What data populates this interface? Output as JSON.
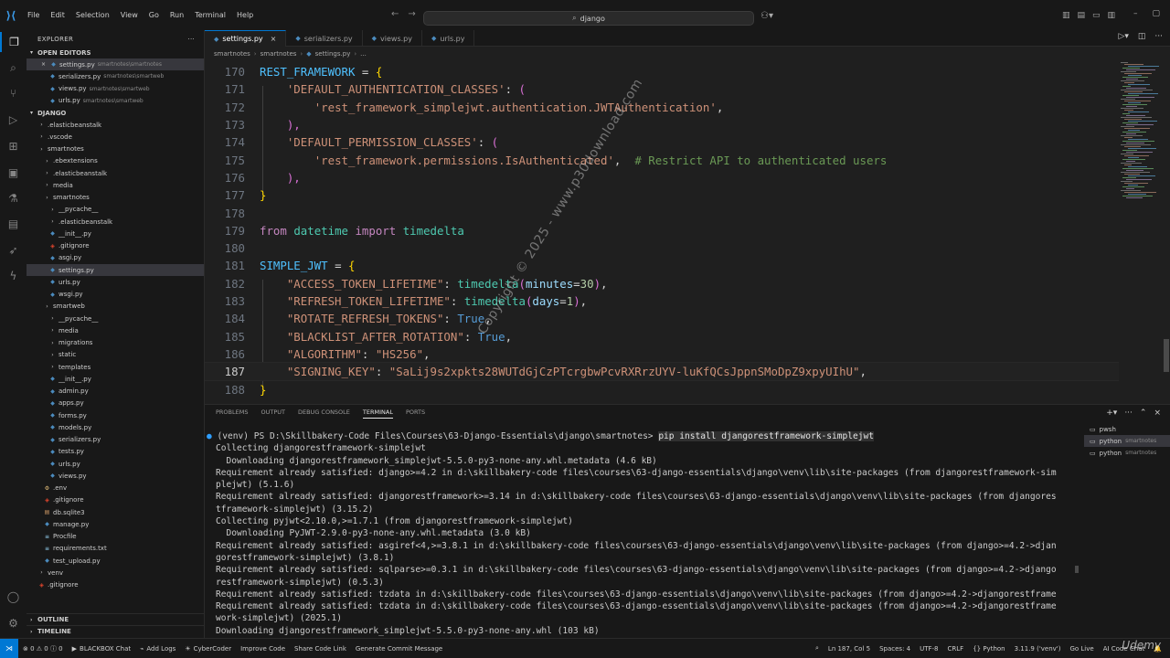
{
  "titlebar": {
    "menu": [
      "File",
      "Edit",
      "Selection",
      "View",
      "Go",
      "Run",
      "Terminal",
      "Help"
    ],
    "search_text": "django"
  },
  "sidebar": {
    "title": "EXPLORER",
    "open_editors_label": "OPEN EDITORS",
    "open_editors": [
      {
        "name": "settings.py",
        "path": "smartnotes\\smartnotes"
      },
      {
        "name": "serializers.py",
        "path": "smartnotes\\smartweb"
      },
      {
        "name": "views.py",
        "path": "smartnotes\\smartweb"
      },
      {
        "name": "urls.py",
        "path": "smartnotes\\smartweb"
      }
    ],
    "workspace_label": "DJANGO",
    "tree": [
      {
        "name": ".elasticbeanstalk",
        "indent": 1,
        "type": "folder"
      },
      {
        "name": ".vscode",
        "indent": 1,
        "type": "folder"
      },
      {
        "name": "smartnotes",
        "indent": 1,
        "type": "folder"
      },
      {
        "name": ".ebextensions",
        "indent": 2,
        "type": "folder"
      },
      {
        "name": ".elasticbeanstalk",
        "indent": 2,
        "type": "folder"
      },
      {
        "name": "media",
        "indent": 2,
        "type": "folder"
      },
      {
        "name": "smartnotes",
        "indent": 2,
        "type": "folder"
      },
      {
        "name": "__pycache__",
        "indent": 3,
        "type": "folder"
      },
      {
        "name": ".elasticbeanstalk",
        "indent": 3,
        "type": "folder"
      },
      {
        "name": "__init__.py",
        "indent": 3,
        "type": "py"
      },
      {
        "name": ".gitignore",
        "indent": 3,
        "type": "git"
      },
      {
        "name": "asgi.py",
        "indent": 3,
        "type": "py"
      },
      {
        "name": "settings.py",
        "indent": 3,
        "type": "py"
      },
      {
        "name": "urls.py",
        "indent": 3,
        "type": "py"
      },
      {
        "name": "wsgi.py",
        "indent": 3,
        "type": "py"
      },
      {
        "name": "smartweb",
        "indent": 2,
        "type": "folder"
      },
      {
        "name": "__pycache__",
        "indent": 3,
        "type": "folder"
      },
      {
        "name": "media",
        "indent": 3,
        "type": "folder"
      },
      {
        "name": "migrations",
        "indent": 3,
        "type": "folder"
      },
      {
        "name": "static",
        "indent": 3,
        "type": "folder"
      },
      {
        "name": "templates",
        "indent": 3,
        "type": "folder"
      },
      {
        "name": "__init__.py",
        "indent": 3,
        "type": "py"
      },
      {
        "name": "admin.py",
        "indent": 3,
        "type": "py"
      },
      {
        "name": "apps.py",
        "indent": 3,
        "type": "py"
      },
      {
        "name": "forms.py",
        "indent": 3,
        "type": "py"
      },
      {
        "name": "models.py",
        "indent": 3,
        "type": "py"
      },
      {
        "name": "serializers.py",
        "indent": 3,
        "type": "py"
      },
      {
        "name": "tests.py",
        "indent": 3,
        "type": "py"
      },
      {
        "name": "urls.py",
        "indent": 3,
        "type": "py"
      },
      {
        "name": "views.py",
        "indent": 3,
        "type": "py"
      },
      {
        "name": ".env",
        "indent": 2,
        "type": "env"
      },
      {
        "name": ".gitignore",
        "indent": 2,
        "type": "git"
      },
      {
        "name": "db.sqlite3",
        "indent": 2,
        "type": "db"
      },
      {
        "name": "manage.py",
        "indent": 2,
        "type": "py"
      },
      {
        "name": "Procfile",
        "indent": 2,
        "type": "txt"
      },
      {
        "name": "requirements.txt",
        "indent": 2,
        "type": "txt"
      },
      {
        "name": "test_upload.py",
        "indent": 2,
        "type": "py"
      },
      {
        "name": "venv",
        "indent": 1,
        "type": "folder"
      },
      {
        "name": ".gitignore",
        "indent": 1,
        "type": "git"
      }
    ],
    "outline_label": "OUTLINE",
    "timeline_label": "TIMELINE"
  },
  "tabs": [
    {
      "label": "settings.py",
      "active": true
    },
    {
      "label": "serializers.py",
      "active": false
    },
    {
      "label": "views.py",
      "active": false
    },
    {
      "label": "urls.py",
      "active": false
    }
  ],
  "breadcrumb": [
    "smartnotes",
    "smartnotes",
    "settings.py",
    "..."
  ],
  "editor": {
    "current_line": 187,
    "lines": [
      {
        "n": 170,
        "tokens": [
          [
            "REST_FRAMEWORK",
            "var"
          ],
          [
            " = ",
            "op"
          ],
          [
            "{",
            "br1"
          ]
        ]
      },
      {
        "n": 171,
        "tokens": [
          [
            "    ",
            "plain"
          ],
          [
            "'DEFAULT_AUTHENTICATION_CLASSES'",
            "str"
          ],
          [
            ": ",
            "op"
          ],
          [
            "(",
            "br2"
          ]
        ]
      },
      {
        "n": 172,
        "tokens": [
          [
            "        ",
            "plain"
          ],
          [
            "'rest_framework_simplejwt.authentication.JWTAuthentication'",
            "str"
          ],
          [
            ",",
            "op"
          ]
        ]
      },
      {
        "n": 173,
        "tokens": [
          [
            "    ",
            "plain"
          ],
          [
            "),",
            "br2"
          ]
        ]
      },
      {
        "n": 174,
        "tokens": [
          [
            "    ",
            "plain"
          ],
          [
            "'DEFAULT_PERMISSION_CLASSES'",
            "str"
          ],
          [
            ": ",
            "op"
          ],
          [
            "(",
            "br2"
          ]
        ]
      },
      {
        "n": 175,
        "tokens": [
          [
            "        ",
            "plain"
          ],
          [
            "'rest_framework.permissions.IsAuthenticated'",
            "str"
          ],
          [
            ",  ",
            "op"
          ],
          [
            "# Restrict API to authenticated users",
            "com"
          ]
        ]
      },
      {
        "n": 176,
        "tokens": [
          [
            "    ",
            "plain"
          ],
          [
            "),",
            "br2"
          ]
        ]
      },
      {
        "n": 177,
        "tokens": [
          [
            "}",
            "br1"
          ]
        ]
      },
      {
        "n": 178,
        "tokens": []
      },
      {
        "n": 179,
        "tokens": [
          [
            "from",
            "kw"
          ],
          [
            " ",
            "plain"
          ],
          [
            "datetime",
            "id"
          ],
          [
            " ",
            "plain"
          ],
          [
            "import",
            "kw"
          ],
          [
            " ",
            "plain"
          ],
          [
            "timedelta",
            "id"
          ]
        ]
      },
      {
        "n": 180,
        "tokens": []
      },
      {
        "n": 181,
        "tokens": [
          [
            "SIMPLE_JWT",
            "var"
          ],
          [
            " = ",
            "op"
          ],
          [
            "{",
            "br1"
          ]
        ]
      },
      {
        "n": 182,
        "tokens": [
          [
            "    ",
            "plain"
          ],
          [
            "\"ACCESS_TOKEN_LIFETIME\"",
            "str"
          ],
          [
            ": ",
            "op"
          ],
          [
            "timedelta",
            "fn"
          ],
          [
            "(",
            "br2"
          ],
          [
            "minutes",
            "param"
          ],
          [
            "=",
            "op"
          ],
          [
            "30",
            "num"
          ],
          [
            ")",
            "br2"
          ],
          [
            ",",
            "op"
          ]
        ]
      },
      {
        "n": 183,
        "tokens": [
          [
            "    ",
            "plain"
          ],
          [
            "\"REFRESH_TOKEN_LIFETIME\"",
            "str"
          ],
          [
            ": ",
            "op"
          ],
          [
            "timedelta",
            "fn"
          ],
          [
            "(",
            "br2"
          ],
          [
            "days",
            "param"
          ],
          [
            "=",
            "op"
          ],
          [
            "1",
            "num"
          ],
          [
            ")",
            "br2"
          ],
          [
            ",",
            "op"
          ]
        ]
      },
      {
        "n": 184,
        "tokens": [
          [
            "    ",
            "plain"
          ],
          [
            "\"ROTATE_REFRESH_TOKENS\"",
            "str"
          ],
          [
            ": ",
            "op"
          ],
          [
            "True",
            "bool"
          ],
          [
            ",",
            "op"
          ]
        ]
      },
      {
        "n": 185,
        "tokens": [
          [
            "    ",
            "plain"
          ],
          [
            "\"BLACKLIST_AFTER_ROTATION\"",
            "str"
          ],
          [
            ": ",
            "op"
          ],
          [
            "True",
            "bool"
          ],
          [
            ",",
            "op"
          ]
        ]
      },
      {
        "n": 186,
        "tokens": [
          [
            "    ",
            "plain"
          ],
          [
            "\"ALGORITHM\"",
            "str"
          ],
          [
            ": ",
            "op"
          ],
          [
            "\"HS256\"",
            "str"
          ],
          [
            ",",
            "op"
          ]
        ]
      },
      {
        "n": 187,
        "tokens": [
          [
            "    ",
            "plain"
          ],
          [
            "\"SIGNING_KEY\"",
            "str"
          ],
          [
            ": ",
            "op"
          ],
          [
            "\"SaLij9s2xpkts28WUTdGjCzPTcrgbwPcvRXRrzUYV-luKfQCsJppnSMoDpZ9xpyUIhU\"",
            "str"
          ],
          [
            ",",
            "op"
          ]
        ]
      },
      {
        "n": 188,
        "tokens": [
          [
            "}",
            "br1"
          ]
        ]
      }
    ]
  },
  "watermark": "Copyright © 2025 - www.p30download.com",
  "panel": {
    "tabs": [
      "PROBLEMS",
      "OUTPUT",
      "DEBUG CONSOLE",
      "TERMINAL",
      "PORTS"
    ],
    "active_tab": "TERMINAL",
    "prompt": "(venv) PS D:\\Skillbakery-Code Files\\Courses\\63-Django-Essentials\\django\\smartnotes>",
    "command": "pip install djangorestframework-simplejwt",
    "output": [
      "Collecting djangorestframework-simplejwt",
      "  Downloading djangorestframework_simplejwt-5.5.0-py3-none-any.whl.metadata (4.6 kB)",
      "Requirement already satisfied: django>=4.2 in d:\\skillbakery-code files\\courses\\63-django-essentials\\django\\venv\\lib\\site-packages (from djangorestframework-sim",
      "plejwt) (5.1.6)",
      "Requirement already satisfied: djangorestframework>=3.14 in d:\\skillbakery-code files\\courses\\63-django-essentials\\django\\venv\\lib\\site-packages (from djangores",
      "tframework-simplejwt) (3.15.2)",
      "Collecting pyjwt<2.10.0,>=1.7.1 (from djangorestframework-simplejwt)",
      "  Downloading PyJWT-2.9.0-py3-none-any.whl.metadata (3.0 kB)",
      "Requirement already satisfied: asgiref<4,>=3.8.1 in d:\\skillbakery-code files\\courses\\63-django-essentials\\django\\venv\\lib\\site-packages (from django>=4.2->djan",
      "gorestframework-simplejwt) (3.8.1)",
      "Requirement already satisfied: sqlparse>=0.3.1 in d:\\skillbakery-code files\\courses\\63-django-essentials\\django\\venv\\lib\\site-packages (from django>=4.2->django",
      "restframework-simplejwt) (0.5.3)",
      "Requirement already satisfied: tzdata in d:\\skillbakery-code files\\courses\\63-django-essentials\\django\\venv\\lib\\site-packages (from django>=4.2->djangorestframe",
      "Requirement already satisfied: tzdata in d:\\skillbakery-code files\\courses\\63-django-essentials\\django\\venv\\lib\\site-packages (from django>=4.2->djangorestframe",
      "work-simplejwt) (2025.1)",
      "Downloading djangorestframework_simplejwt-5.5.0-py3-none-any.whl (103 kB)"
    ],
    "terminals": [
      {
        "name": "pwsh",
        "sub": ""
      },
      {
        "name": "python",
        "sub": "smartnotes"
      },
      {
        "name": "python",
        "sub": "smartnotes"
      }
    ]
  },
  "statusbar": {
    "problems": "⊗ 0 ⚠ 0 ⓘ 0",
    "left_items": [
      "BLACKBOX Chat",
      "Add Logs",
      "CyberCoder",
      "Improve Code",
      "Share Code Link",
      "Generate Commit Message"
    ],
    "right_items": [
      "Ln 187, Col 5",
      "Spaces: 4",
      "UTF-8",
      "CRLF",
      "{} Python",
      "3.11.9 ('venv')",
      "Go Live",
      "AI Code Chat"
    ]
  },
  "brand_watermark": "Udemy",
  "colors": {
    "accent": "#0078d4",
    "background": "#1f1f1f",
    "sidebar_bg": "#181818"
  }
}
